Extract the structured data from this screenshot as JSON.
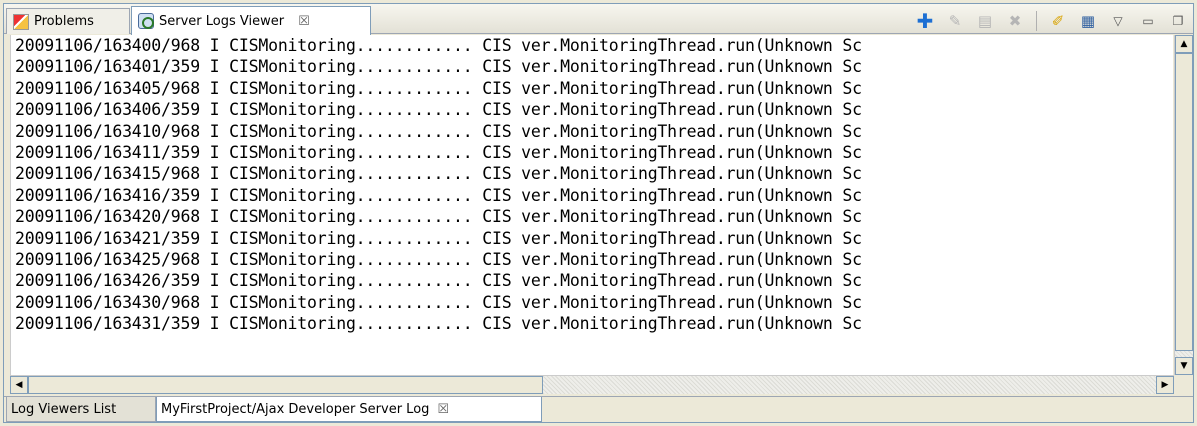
{
  "tabs": {
    "problems_label": "Problems",
    "viewer_label": "Server Logs Viewer",
    "viewer_close": "☒"
  },
  "toolbar": {
    "icons": [
      "add-icon",
      "edit-icon",
      "copy-icon",
      "delete-icon",
      "clear-icon",
      "properties-icon",
      "view-menu-icon",
      "minimize-icon",
      "maximize-icon"
    ]
  },
  "log": {
    "lines": [
      "20091106/163400/968 I CISMonitoring............ CIS ver.MonitoringThread.run(Unknown Sc",
      "20091106/163401/359 I CISMonitoring............ CIS ver.MonitoringThread.run(Unknown Sc",
      "20091106/163405/968 I CISMonitoring............ CIS ver.MonitoringThread.run(Unknown Sc",
      "20091106/163406/359 I CISMonitoring............ CIS ver.MonitoringThread.run(Unknown Sc",
      "20091106/163410/968 I CISMonitoring............ CIS ver.MonitoringThread.run(Unknown Sc",
      "20091106/163411/359 I CISMonitoring............ CIS ver.MonitoringThread.run(Unknown Sc",
      "20091106/163415/968 I CISMonitoring............ CIS ver.MonitoringThread.run(Unknown Sc",
      "20091106/163416/359 I CISMonitoring............ CIS ver.MonitoringThread.run(Unknown Sc",
      "20091106/163420/968 I CISMonitoring............ CIS ver.MonitoringThread.run(Unknown Sc",
      "20091106/163421/359 I CISMonitoring............ CIS ver.MonitoringThread.run(Unknown Sc",
      "20091106/163425/968 I CISMonitoring............ CIS ver.MonitoringThread.run(Unknown Sc",
      "20091106/163426/359 I CISMonitoring............ CIS ver.MonitoringThread.run(Unknown Sc",
      "20091106/163430/968 I CISMonitoring............ CIS ver.MonitoringThread.run(Unknown Sc",
      "20091106/163431/359 I CISMonitoring............ CIS ver.MonitoringThread.run(Unknown Sc"
    ]
  },
  "bottom_tabs": {
    "list_label": "Log Viewers List",
    "log_label": "MyFirstProject/Ajax Developer Server Log",
    "log_close": "☒"
  }
}
